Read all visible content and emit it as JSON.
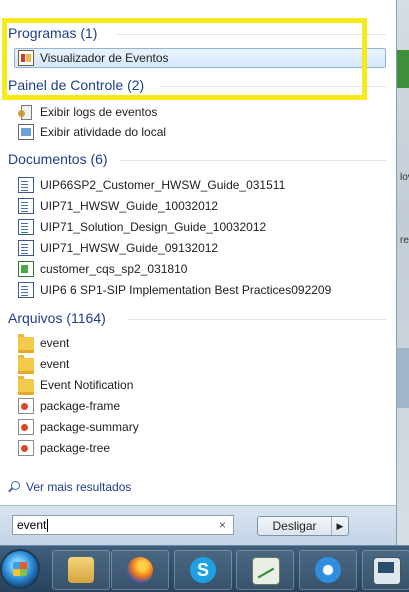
{
  "sections": {
    "programs": {
      "header": "Programas (1)",
      "items": [
        {
          "label": "Visualizador de Eventos",
          "icon": "event-viewer-icon",
          "selected": true
        }
      ]
    },
    "control_panel": {
      "header": "Painel de Controle (2)",
      "items": [
        {
          "label": "Exibir logs de eventos",
          "icon": "event-log-icon"
        },
        {
          "label": "Exibir atividade do local",
          "icon": "activity-icon"
        }
      ]
    },
    "documents": {
      "header": "Documentos (6)",
      "items": [
        {
          "label": "UIP66SP2_Customer_HWSW_Guide_031511",
          "icon": "word-doc-icon"
        },
        {
          "label": "UIP71_HWSW_Guide_10032012",
          "icon": "word-doc-icon"
        },
        {
          "label": "UIP71_Solution_Design_Guide_10032012",
          "icon": "word-doc-icon"
        },
        {
          "label": "UIP71_HWSW_Guide_09132012",
          "icon": "word-doc-icon"
        },
        {
          "label": "customer_cqs_sp2_031810",
          "icon": "excel-doc-icon"
        },
        {
          "label": "UIP6 6 SP1-SIP Implementation Best Practices092209",
          "icon": "word-doc-icon"
        }
      ]
    },
    "files": {
      "header": "Arquivos (1164)",
      "items": [
        {
          "label": "event",
          "icon": "folder-icon"
        },
        {
          "label": "event",
          "icon": "folder-icon"
        },
        {
          "label": "Event Notification",
          "icon": "folder-icon"
        },
        {
          "label": "package-frame",
          "icon": "html-file-icon"
        },
        {
          "label": "package-summary",
          "icon": "html-file-icon"
        },
        {
          "label": "package-tree",
          "icon": "html-file-icon"
        }
      ]
    }
  },
  "more_results": "Ver mais resultados",
  "search": {
    "value": "event",
    "clear_symbol": "×"
  },
  "shutdown": {
    "label": "Desligar",
    "arrow": "▶"
  },
  "taskbar": {
    "apps": [
      "windows-explorer",
      "firefox",
      "skype",
      "performance-monitor",
      "internet-explorer",
      "remote-desktop"
    ],
    "skype_glyph": "S"
  },
  "colors": {
    "highlight": "#f6ea1a",
    "section_header": "#1e3e8c",
    "taskbar": "#27435e"
  },
  "background_fragments": {
    "a": "lov",
    "b": "re"
  }
}
